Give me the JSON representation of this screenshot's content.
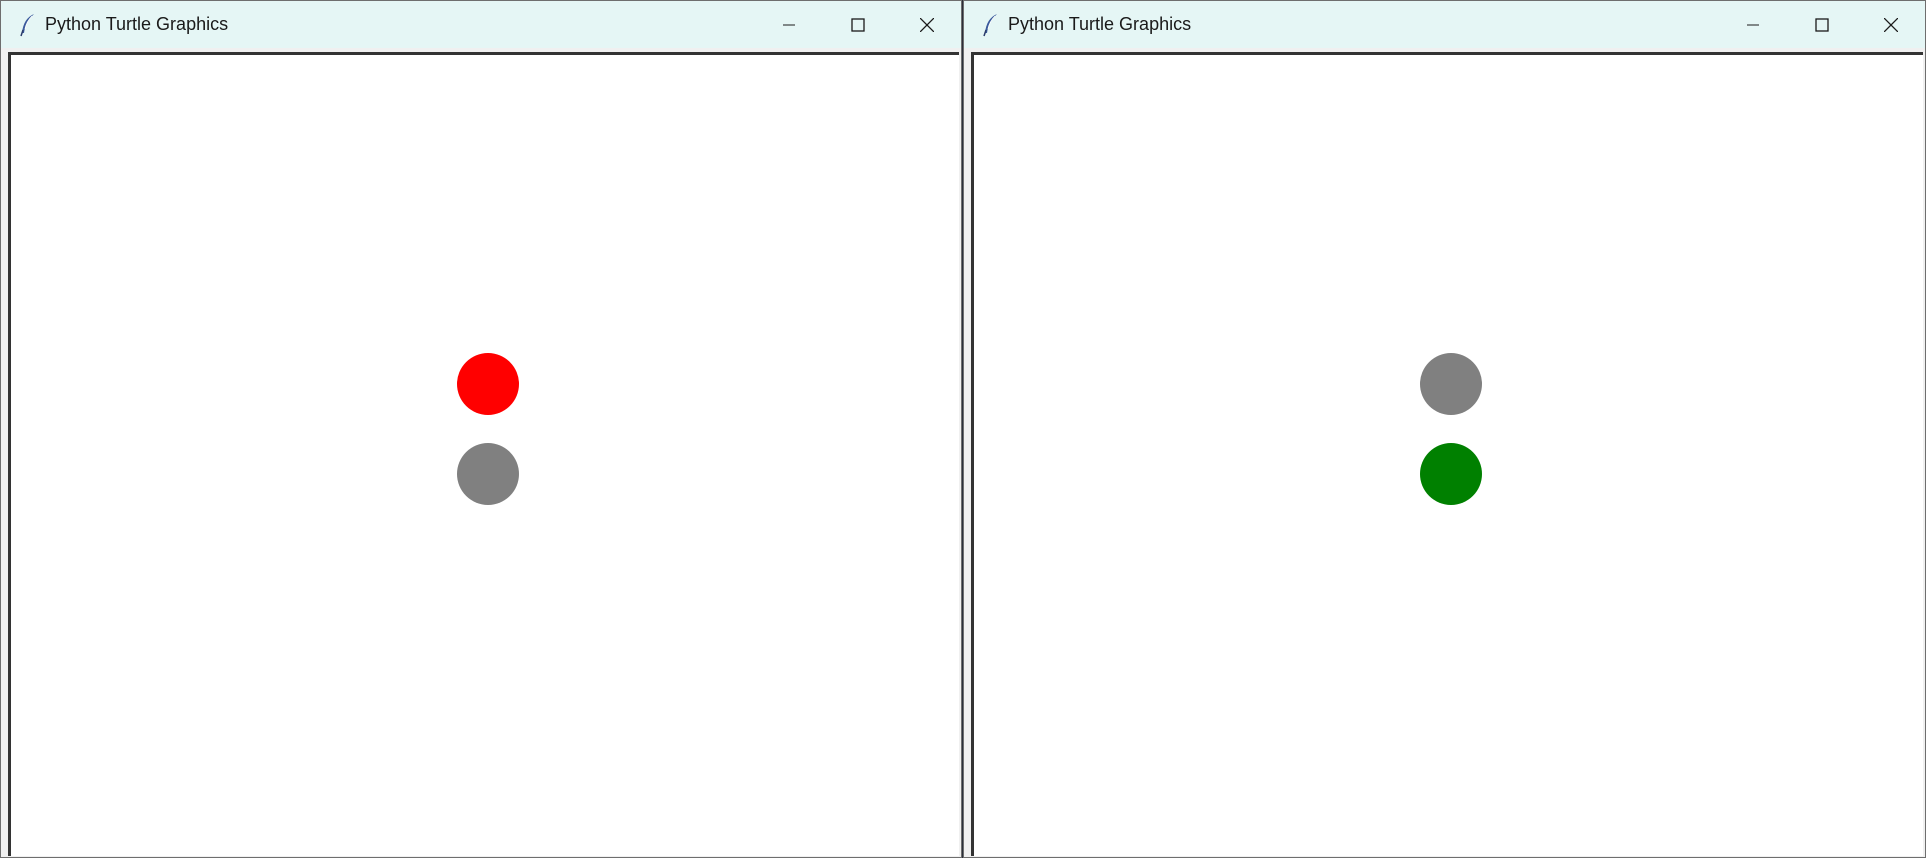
{
  "windows": [
    {
      "title": "Python Turtle Graphics",
      "lights": [
        {
          "name": "top-light",
          "color": "#ff0000"
        },
        {
          "name": "bottom-light",
          "color": "#808080"
        }
      ]
    },
    {
      "title": "Python Turtle Graphics",
      "lights": [
        {
          "name": "top-light",
          "color": "#808080"
        },
        {
          "name": "bottom-light",
          "color": "#008000"
        }
      ]
    }
  ],
  "icons": {
    "app": "feather-icon",
    "minimize": "minimize-icon",
    "maximize": "maximize-icon",
    "close": "close-icon"
  }
}
